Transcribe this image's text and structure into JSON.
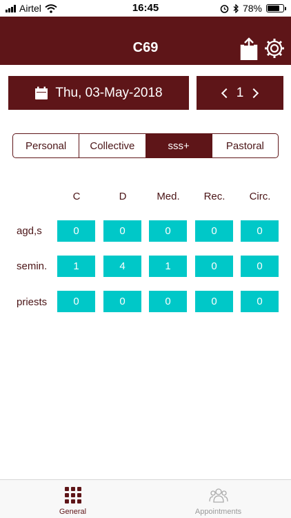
{
  "status_bar": {
    "carrier": "Airtel",
    "time": "16:45",
    "battery": "78%",
    "battery_level": 0.78
  },
  "header": {
    "title": "C69",
    "share_icon": "share-icon",
    "settings_icon": "gear-icon"
  },
  "date_selector": {
    "date": "Thu, 03-May-2018",
    "icon": "calendar-icon"
  },
  "page_nav": {
    "value": "1"
  },
  "segments": [
    {
      "label": "Personal",
      "active": false
    },
    {
      "label": "Collective",
      "active": false
    },
    {
      "label": "sss+",
      "active": true
    },
    {
      "label": "Pastoral",
      "active": false
    }
  ],
  "grid": {
    "columns": [
      "C",
      "D",
      "Med.",
      "Rec.",
      "Circ."
    ],
    "rows": [
      {
        "label": "agd,s",
        "values": [
          "0",
          "0",
          "0",
          "0",
          "0"
        ]
      },
      {
        "label": "semin.",
        "values": [
          "1",
          "4",
          "1",
          "0",
          "0"
        ]
      },
      {
        "label": "priests",
        "values": [
          "0",
          "0",
          "0",
          "0",
          "0"
        ]
      }
    ]
  },
  "tab_bar": {
    "tabs": [
      {
        "label": "General",
        "icon": "grid-icon",
        "active": true
      },
      {
        "label": "Appointments",
        "icon": "people-icon",
        "active": false
      }
    ]
  },
  "colors": {
    "primary": "#5e1518",
    "cell": "#00c8c8",
    "text_dark": "#4a1416"
  }
}
